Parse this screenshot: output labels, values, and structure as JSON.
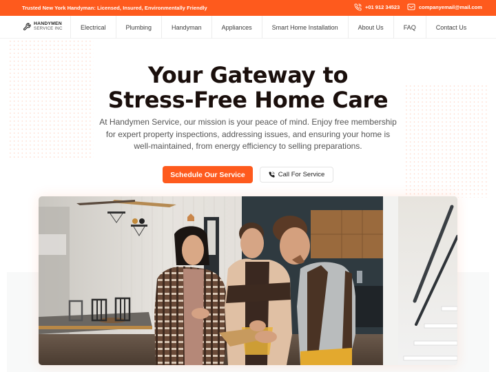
{
  "topbar": {
    "tagline": "Trusted New York Handyman: Licensed, Insured, Environmentally Friendly",
    "phone": "+01 912 34523",
    "phone_icon": "phone-icon",
    "email": "companyemail@mail.com",
    "email_icon": "mail-icon"
  },
  "nav": {
    "logo": {
      "line1": "HANDYMEN",
      "line2": "SERVICE INC",
      "icon": "wrench-icon"
    },
    "items": [
      {
        "label": "Electrical"
      },
      {
        "label": "Plumbing"
      },
      {
        "label": "Handyman"
      },
      {
        "label": "Appliances"
      },
      {
        "label": "Smart Home Installation"
      },
      {
        "label": "About Us"
      },
      {
        "label": "FAQ"
      },
      {
        "label": "Contact Us"
      }
    ]
  },
  "hero": {
    "title_line1": "Your Gateway to",
    "title_line2": "Stress-Free Home Care",
    "subtitle": "At Handymen Service, our mission is your peace of mind. Enjoy free membership for expert property inspections, addressing issues, and ensuring your home is well-maintained, from energy efficiency to selling preparations.",
    "primary_button": "Schedule Our Service",
    "secondary_button": "Call For Service",
    "secondary_icon": "phone-icon",
    "image_alt": "Two handymen reviewing a clipboard with a homeowner in a bright living room"
  },
  "colors": {
    "accent": "#fe5a1d",
    "heading": "#1a0f0c",
    "body_text": "#555555"
  }
}
